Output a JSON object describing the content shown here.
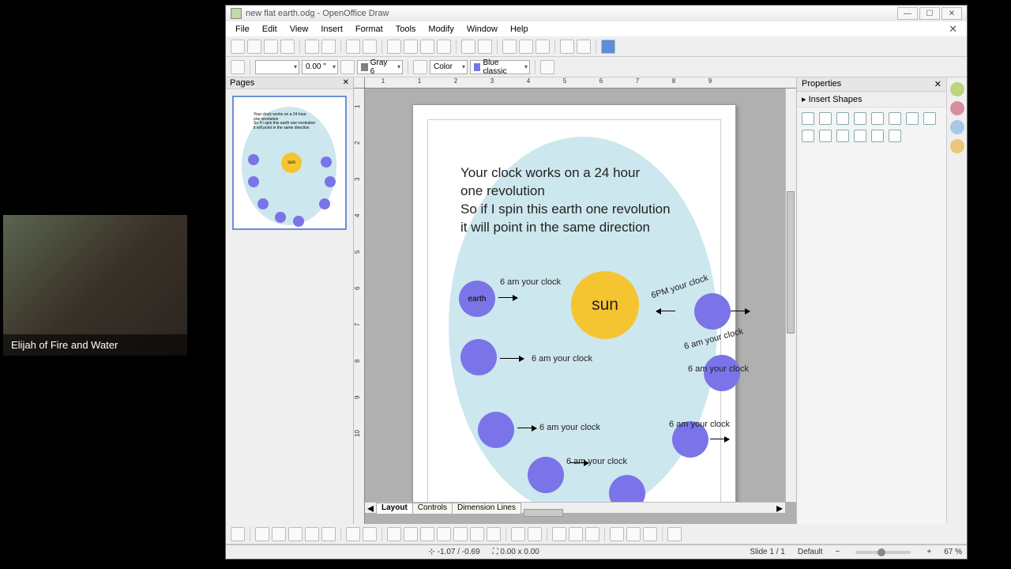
{
  "webcam": {
    "name": "Elijah of Fire and Water"
  },
  "titlebar": {
    "doc": "new flat earth.odg - OpenOffice Draw"
  },
  "menu": {
    "file": "File",
    "edit": "Edit",
    "view": "View",
    "insert": "Insert",
    "format": "Format",
    "tools": "Tools",
    "modify": "Modify",
    "window": "Window",
    "help": "Help"
  },
  "toolbar2": {
    "lineWidth": "0.00 \"",
    "lineColor": "Gray 6",
    "fillMode": "Color",
    "fillColor": "Blue classic"
  },
  "panels": {
    "pages": "Pages",
    "properties": "Properties",
    "insertShapes": "Insert Shapes"
  },
  "doc": {
    "line1": "Your clock works on a 24 hour",
    "line2": "one revolution",
    "line3": "So if I spin this earth one revolution",
    "line4": " it will point in the same direction",
    "sun": "sun",
    "earth": "earth",
    "labels": {
      "l1": "6 am your clock",
      "l2": "6 am your clock",
      "l3": "6 am your clock",
      "l4": "6 am your clock",
      "l5": "6PM your clock",
      "l6": "6 am your clock",
      "l7": "6 am your clock",
      "l8": "6 am your clock"
    }
  },
  "tabs": {
    "layout": "Layout",
    "controls": "Controls",
    "dimension": "Dimension Lines"
  },
  "rulerH": [
    "1",
    "1",
    "2",
    "3",
    "4",
    "5",
    "6",
    "7",
    "8",
    "9"
  ],
  "rulerV": [
    "1",
    "2",
    "3",
    "4",
    "5",
    "6",
    "7",
    "8",
    "9",
    "10"
  ],
  "status": {
    "pos": "-1.07 / -0.69",
    "size": "0.00 x 0.00",
    "slide": "Slide 1 / 1",
    "style": "Default",
    "zoom": "67 %"
  }
}
